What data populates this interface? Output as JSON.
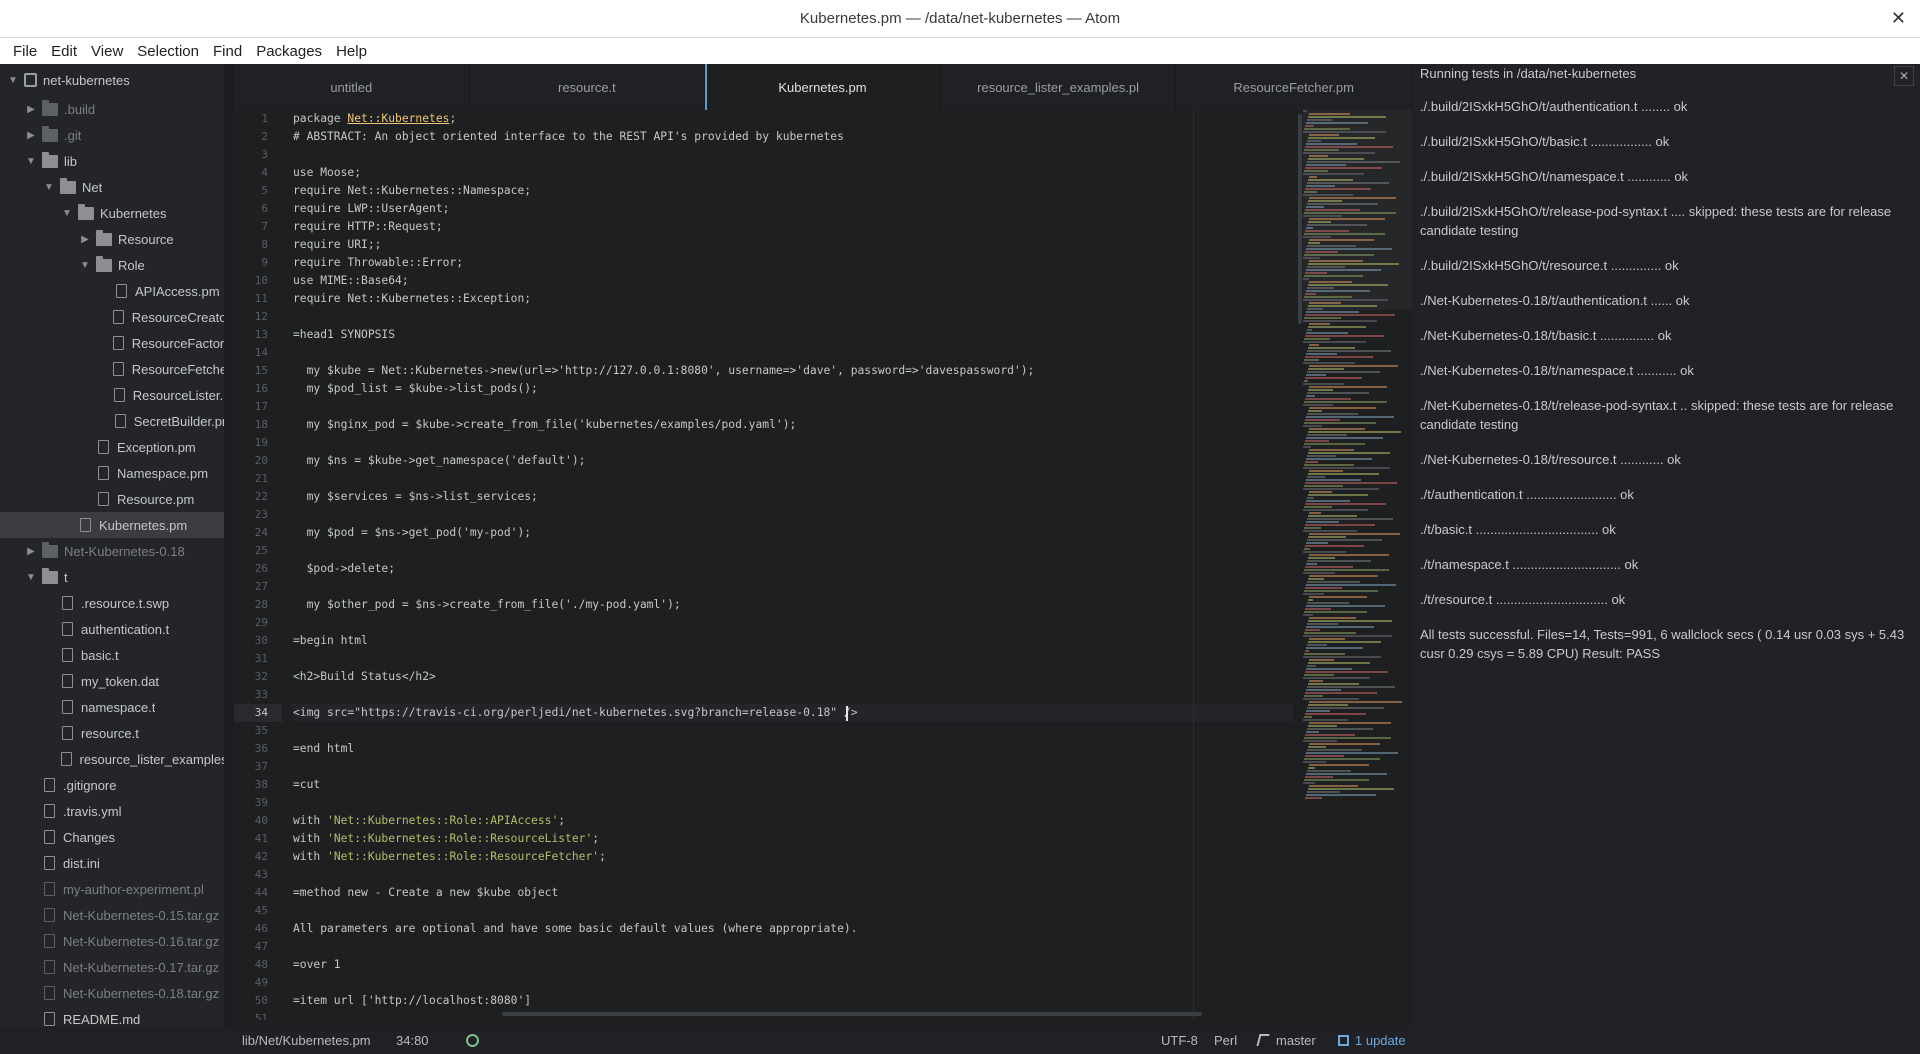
{
  "window": {
    "title": "Kubernetes.pm — /data/net-kubernetes — Atom",
    "close_glyph": "✕"
  },
  "menu": [
    "File",
    "Edit",
    "View",
    "Selection",
    "Find",
    "Packages",
    "Help"
  ],
  "tree": {
    "root": "net-kubernetes",
    "items": [
      {
        "label": ".build",
        "type": "folder",
        "depth": 1,
        "expanded": false,
        "muted": true
      },
      {
        "label": ".git",
        "type": "folder",
        "depth": 1,
        "expanded": false,
        "muted": true
      },
      {
        "label": "lib",
        "type": "folder",
        "depth": 1,
        "expanded": true,
        "muted": false
      },
      {
        "label": "Net",
        "type": "folder",
        "depth": 2,
        "expanded": true,
        "muted": false
      },
      {
        "label": "Kubernetes",
        "type": "folder",
        "depth": 3,
        "expanded": true,
        "muted": false
      },
      {
        "label": "Resource",
        "type": "folder",
        "depth": 4,
        "expanded": false,
        "muted": false
      },
      {
        "label": "Role",
        "type": "folder",
        "depth": 4,
        "expanded": true,
        "muted": false
      },
      {
        "label": "APIAccess.pm",
        "type": "file",
        "depth": 5,
        "muted": false
      },
      {
        "label": "ResourceCreator.pm",
        "type": "file",
        "depth": 5,
        "muted": false
      },
      {
        "label": "ResourceFactory.pm",
        "type": "file",
        "depth": 5,
        "muted": false
      },
      {
        "label": "ResourceFetcher.pm",
        "type": "file",
        "depth": 5,
        "muted": false
      },
      {
        "label": "ResourceLister.pm",
        "type": "file",
        "depth": 5,
        "muted": false
      },
      {
        "label": "SecretBuilder.pm",
        "type": "file",
        "depth": 5,
        "muted": false
      },
      {
        "label": "Exception.pm",
        "type": "file",
        "depth": 4,
        "muted": false
      },
      {
        "label": "Namespace.pm",
        "type": "file",
        "depth": 4,
        "muted": false
      },
      {
        "label": "Resource.pm",
        "type": "file",
        "depth": 4,
        "muted": false
      },
      {
        "label": "Kubernetes.pm",
        "type": "file",
        "depth": 3,
        "muted": false,
        "selected": true
      },
      {
        "label": "Net-Kubernetes-0.18",
        "type": "folder",
        "depth": 1,
        "expanded": false,
        "muted": true
      },
      {
        "label": "t",
        "type": "folder",
        "depth": 1,
        "expanded": true,
        "muted": false
      },
      {
        "label": ".resource.t.swp",
        "type": "file",
        "depth": 2,
        "muted": false
      },
      {
        "label": "authentication.t",
        "type": "file",
        "depth": 2,
        "muted": false
      },
      {
        "label": "basic.t",
        "type": "file",
        "depth": 2,
        "muted": false
      },
      {
        "label": "my_token.dat",
        "type": "file",
        "depth": 2,
        "muted": false
      },
      {
        "label": "namespace.t",
        "type": "file",
        "depth": 2,
        "muted": false
      },
      {
        "label": "resource.t",
        "type": "file",
        "depth": 2,
        "muted": false
      },
      {
        "label": "resource_lister_examples.pl",
        "type": "file",
        "depth": 2,
        "muted": false
      },
      {
        "label": ".gitignore",
        "type": "file",
        "depth": 1,
        "muted": false
      },
      {
        "label": ".travis.yml",
        "type": "file",
        "depth": 1,
        "muted": false
      },
      {
        "label": "Changes",
        "type": "file",
        "depth": 1,
        "muted": false
      },
      {
        "label": "dist.ini",
        "type": "file",
        "depth": 1,
        "muted": false
      },
      {
        "label": "my-author-experiment.pl",
        "type": "file",
        "depth": 1,
        "muted": true
      },
      {
        "label": "Net-Kubernetes-0.15.tar.gz",
        "type": "file",
        "depth": 1,
        "muted": true
      },
      {
        "label": "Net-Kubernetes-0.16.tar.gz",
        "type": "file",
        "depth": 1,
        "muted": true
      },
      {
        "label": "Net-Kubernetes-0.17.tar.gz",
        "type": "file",
        "depth": 1,
        "muted": true
      },
      {
        "label": "Net-Kubernetes-0.18.tar.gz",
        "type": "file",
        "depth": 1,
        "muted": true
      },
      {
        "label": "README.md",
        "type": "file",
        "depth": 1,
        "muted": false
      }
    ]
  },
  "tabs": [
    {
      "label": "untitled",
      "active": false
    },
    {
      "label": "resource.t",
      "active": false
    },
    {
      "label": "Kubernetes.pm",
      "active": true
    },
    {
      "label": "resource_lister_examples.pl",
      "active": false
    },
    {
      "label": "ResourceFetcher.pm",
      "active": false
    }
  ],
  "editor": {
    "current_line": 34,
    "lines": [
      "package Net::Kubernetes;",
      "# ABSTRACT: An object oriented interface to the REST API's provided by kubernetes",
      "",
      "use Moose;",
      "require Net::Kubernetes::Namespace;",
      "require LWP::UserAgent;",
      "require HTTP::Request;",
      "require URI;;",
      "require Throwable::Error;",
      "use MIME::Base64;",
      "require Net::Kubernetes::Exception;",
      "",
      "=head1 SYNOPSIS",
      "",
      "  my $kube = Net::Kubernetes->new(url=>'http://127.0.0.1:8080', username=>'dave', password=>'davespassword');",
      "  my $pod_list = $kube->list_pods();",
      "",
      "  my $nginx_pod = $kube->create_from_file('kubernetes/examples/pod.yaml');",
      "",
      "  my $ns = $kube->get_namespace('default');",
      "",
      "  my $services = $ns->list_services;",
      "",
      "  my $pod = $ns->get_pod('my-pod');",
      "",
      "  $pod->delete;",
      "",
      "  my $other_pod = $ns->create_from_file('./my-pod.yaml');",
      "",
      "=begin html",
      "",
      "<h2>Build Status</h2>",
      "",
      "<img src=\"https://travis-ci.org/perljedi/net-kubernetes.svg?branch=release-0.18\" />",
      "",
      "=end html",
      "",
      "=cut",
      "",
      "with 'Net::Kubernetes::Role::APIAccess';",
      "with 'Net::Kubernetes::Role::ResourceLister';",
      "with 'Net::Kubernetes::Role::ResourceFetcher';",
      "",
      "=method new - Create a new $kube object",
      "",
      "All parameters are optional and have some basic default values (where appropriate).",
      "",
      "=over 1",
      "",
      "=item url ['http://localhost:8080']",
      ""
    ]
  },
  "panel": {
    "close_glyph": "✕",
    "lines": [
      "Running tests in /data/net-kubernetes",
      "./.build/2ISxkH5GhO/t/authentication.t ........ ok",
      "./.build/2ISxkH5GhO/t/basic.t ................. ok",
      "./.build/2ISxkH5GhO/t/namespace.t ............ ok",
      "./.build/2ISxkH5GhO/t/release-pod-syntax.t .... skipped: these tests are for release candidate testing",
      "./.build/2ISxkH5GhO/t/resource.t .............. ok",
      "./Net-Kubernetes-0.18/t/authentication.t ...... ok",
      "./Net-Kubernetes-0.18/t/basic.t ............... ok",
      "./Net-Kubernetes-0.18/t/namespace.t ........... ok",
      "./Net-Kubernetes-0.18/t/release-pod-syntax.t .. skipped: these tests are for release candidate testing",
      "./Net-Kubernetes-0.18/t/resource.t ............ ok",
      "./t/authentication.t ......................... ok",
      "./t/basic.t .................................. ok",
      "./t/namespace.t .............................. ok",
      "./t/resource.t ............................... ok",
      "All tests successful. Files=14, Tests=991, 6 wallclock secs ( 0.14 usr 0.03 sys + 5.43 cusr 0.29 csys = 5.89 CPU) Result: PASS"
    ]
  },
  "status": {
    "path": "lib/Net/Kubernetes.pm",
    "position": "34:80",
    "encoding": "UTF-8",
    "grammar": "Perl",
    "branch": "master",
    "updates": "1 update"
  },
  "colors": {
    "accent": "#5c9bd6",
    "string": "#b5bd68",
    "highlight": "#f0c674",
    "update": "#6fa8dc",
    "ok_gear": "#7fbf8b"
  }
}
